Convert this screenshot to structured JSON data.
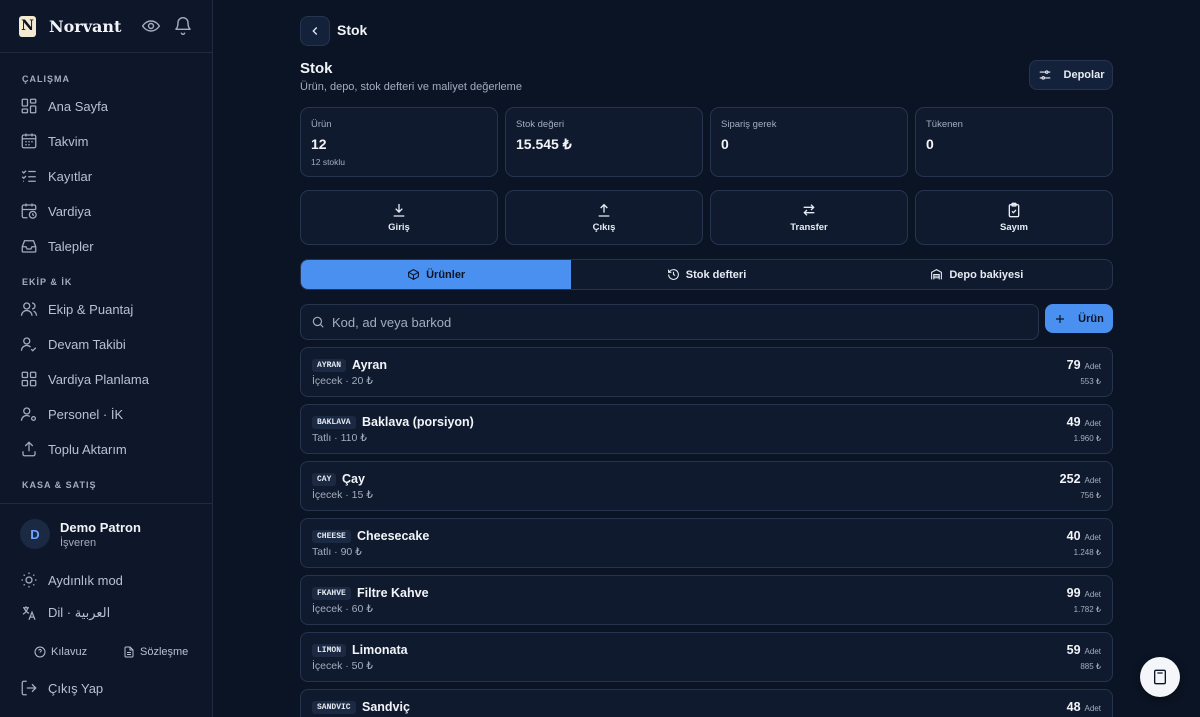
{
  "brand": {
    "logo_letter": "N",
    "name": "Norvant"
  },
  "sidebar": {
    "sections": [
      {
        "label": "ÇALIŞMA",
        "items": [
          {
            "label": "Ana Sayfa",
            "icon": "grid-icon"
          },
          {
            "label": "Takvim",
            "icon": "calendar-icon"
          },
          {
            "label": "Kayıtlar",
            "icon": "checklist-icon"
          },
          {
            "label": "Vardiya",
            "icon": "calendar-clock-icon"
          },
          {
            "label": "Talepler",
            "icon": "inbox-icon"
          }
        ]
      },
      {
        "label": "EKİP & İK",
        "items": [
          {
            "label": "Ekip & Puantaj",
            "icon": "users-icon"
          },
          {
            "label": "Devam Takibi",
            "icon": "user-check-icon"
          },
          {
            "label": "Vardiya Planlama",
            "icon": "grid-icon"
          },
          {
            "label": "Personel · İK",
            "icon": "user-cog-icon"
          },
          {
            "label": "Toplu Aktarım",
            "icon": "upload-icon"
          }
        ]
      },
      {
        "label": "KASA & SATIŞ",
        "items": []
      }
    ],
    "user": {
      "initial": "D",
      "name": "Demo Patron",
      "role": "İşveren"
    },
    "theme_label": "Aydınlık mod",
    "language_label": "Dil · العربية",
    "guide_label": "Kılavuz",
    "contract_label": "Sözleşme",
    "logout_label": "Çıkış Yap"
  },
  "header": {
    "title": "Stok"
  },
  "page": {
    "title": "Stok",
    "subtitle": "Ürün, depo, stok defteri ve maliyet değerleme",
    "warehouses_label": "Depolar"
  },
  "stats": [
    {
      "label": "Ürün",
      "value": "12",
      "sub": "12 stoklu"
    },
    {
      "label": "Stok değeri",
      "value": "15.545 ₺",
      "sub": ""
    },
    {
      "label": "Sipariş gerek",
      "value": "0",
      "sub": ""
    },
    {
      "label": "Tükenen",
      "value": "0",
      "sub": ""
    }
  ],
  "actions": [
    {
      "label": "Giriş",
      "icon": "download-icon"
    },
    {
      "label": "Çıkış",
      "icon": "upload-icon"
    },
    {
      "label": "Transfer",
      "icon": "transfer-icon"
    },
    {
      "label": "Sayım",
      "icon": "clipboard-check-icon"
    }
  ],
  "tabs": [
    {
      "label": "Ürünler",
      "icon": "box-icon",
      "active": true
    },
    {
      "label": "Stok defteri",
      "icon": "history-icon",
      "active": false
    },
    {
      "label": "Depo bakiyesi",
      "icon": "warehouse-icon",
      "active": false
    }
  ],
  "search": {
    "placeholder": "Kod, ad veya barkod",
    "value": ""
  },
  "add_button_label": "Ürün",
  "products": [
    {
      "code": "AYRAN",
      "name": "Ayran",
      "meta": "İçecek · 20 ₺",
      "qty": "79",
      "unit": "Adet",
      "value": "553 ₺"
    },
    {
      "code": "BAKLAVA",
      "name": "Baklava (porsiyon)",
      "meta": "Tatlı · 110 ₺",
      "qty": "49",
      "unit": "Adet",
      "value": "1.960 ₺"
    },
    {
      "code": "CAY",
      "name": "Çay",
      "meta": "İçecek · 15 ₺",
      "qty": "252",
      "unit": "Adet",
      "value": "756 ₺"
    },
    {
      "code": "CHEESE",
      "name": "Cheesecake",
      "meta": "Tatlı · 90 ₺",
      "qty": "40",
      "unit": "Adet",
      "value": "1.248 ₺"
    },
    {
      "code": "FKAHVE",
      "name": "Filtre Kahve",
      "meta": "İçecek · 60 ₺",
      "qty": "99",
      "unit": "Adet",
      "value": "1.782 ₺"
    },
    {
      "code": "LIMON",
      "name": "Limonata",
      "meta": "İçecek · 50 ₺",
      "qty": "59",
      "unit": "Adet",
      "value": "885 ₺"
    },
    {
      "code": "SANDVIC",
      "name": "Sandviç",
      "meta": "",
      "qty": "48",
      "unit": "Adet",
      "value": ""
    }
  ],
  "colors": {
    "accent": "#4a90f0",
    "background": "#0b1424",
    "card": "#0f1a2e",
    "border": "#26344d"
  }
}
